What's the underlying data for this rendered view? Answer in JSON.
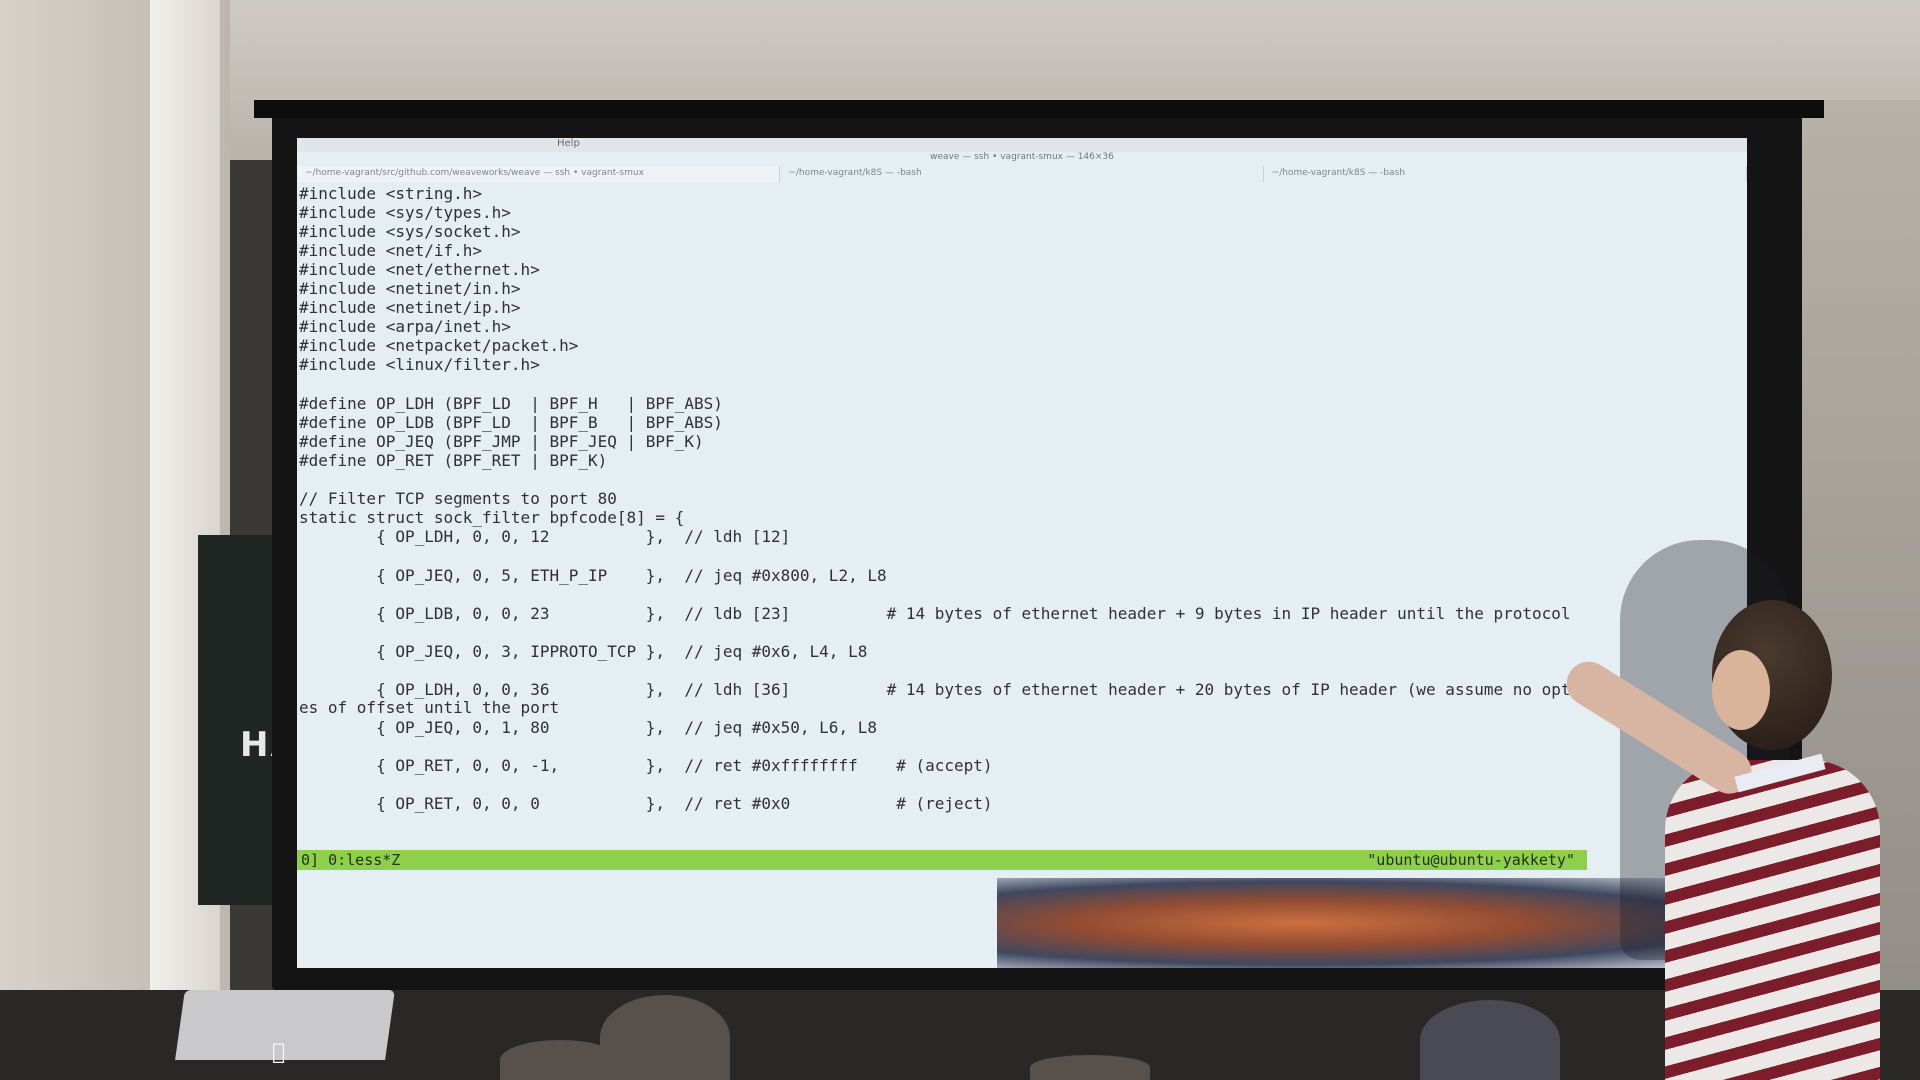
{
  "os_menu": [
    "Help"
  ],
  "window_title": "weave — ssh • vagrant-smux — 146×36",
  "tabs": [
    {
      "label": "~/home-vagrant/src/github.com/weaveworks/weave — ssh • vagrant-smux"
    },
    {
      "label": "~/home-vagrant/k8S — -bash"
    },
    {
      "label": "~/home-vagrant/k8S — -bash"
    }
  ],
  "code_lines": [
    "#include <string.h>",
    "#include <sys/types.h>",
    "#include <sys/socket.h>",
    "#include <net/if.h>",
    "#include <net/ethernet.h>",
    "#include <netinet/in.h>",
    "#include <netinet/ip.h>",
    "#include <arpa/inet.h>",
    "#include <netpacket/packet.h>",
    "#include <linux/filter.h>",
    "#define OP_LDH (BPF_LD  | BPF_H   | BPF_ABS)",
    "#define OP_LDB (BPF_LD  | BPF_B   | BPF_ABS)",
    "#define OP_JEQ (BPF_JMP | BPF_JEQ | BPF_K)",
    "#define OP_RET (BPF_RET | BPF_K)",
    "// Filter TCP segments to port 80",
    "static struct sock_filter bpfcode[8] = {",
    "        { OP_LDH, 0, 0, 12          },  // ldh [12]",
    "        { OP_JEQ, 0, 5, ETH_P_IP    },  // jeq #0x800, L2, L8",
    "        { OP_LDB, 0, 0, 23          },  // ldb [23]          # 14 bytes of ethernet header + 9 bytes in IP header until the protocol",
    "        { OP_JEQ, 0, 3, IPPROTO_TCP },  // jeq #0x6, L4, L8",
    "        { OP_LDH, 0, 0, 36          },  // ldh [36]          # 14 bytes of ethernet header + 20 bytes of IP header (we assume no options)",
    "es of offset until the port",
    "        { OP_JEQ, 0, 1, 80          },  // jeq #0x50, L6, L8",
    "        { OP_RET, 0, 0, -1,         },  // ret #0xffffffff    # (accept)",
    "        { OP_RET, 0, 0, 0           },  // ret #0x0           # (reject)"
  ],
  "status_left": "0] 0:less*Z",
  "status_right": "\"ubuntu@ubuntu-yakkety\"",
  "banner_text": "HA"
}
